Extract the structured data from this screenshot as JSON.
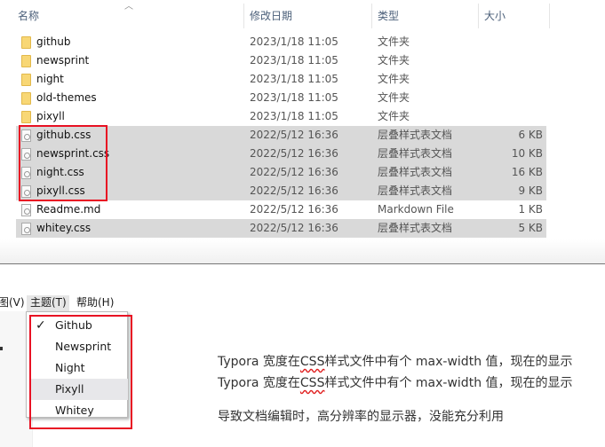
{
  "explorer": {
    "headers": {
      "name": "名称",
      "date": "修改日期",
      "type": "类型",
      "size": "大小"
    },
    "rows": [
      {
        "name": "github",
        "date": "2023/1/18 11:05",
        "type": "文件夹",
        "size": "",
        "icon": "folder",
        "selected": false
      },
      {
        "name": "newsprint",
        "date": "2023/1/18 11:05",
        "type": "文件夹",
        "size": "",
        "icon": "folder",
        "selected": false
      },
      {
        "name": "night",
        "date": "2023/1/18 11:05",
        "type": "文件夹",
        "size": "",
        "icon": "folder",
        "selected": false
      },
      {
        "name": "old-themes",
        "date": "2023/1/18 11:05",
        "type": "文件夹",
        "size": "",
        "icon": "folder",
        "selected": false
      },
      {
        "name": "pixyll",
        "date": "2023/1/18 11:05",
        "type": "文件夹",
        "size": "",
        "icon": "folder",
        "selected": false
      },
      {
        "name": "github.css",
        "date": "2022/5/12 16:36",
        "type": "层叠样式表文档",
        "size": "6 KB",
        "icon": "css",
        "selected": true
      },
      {
        "name": "newsprint.css",
        "date": "2022/5/12 16:36",
        "type": "层叠样式表文档",
        "size": "10 KB",
        "icon": "css",
        "selected": true
      },
      {
        "name": "night.css",
        "date": "2022/5/12 16:36",
        "type": "层叠样式表文档",
        "size": "16 KB",
        "icon": "css",
        "selected": true
      },
      {
        "name": "pixyll.css",
        "date": "2022/5/12 16:36",
        "type": "层叠样式表文档",
        "size": "9 KB",
        "icon": "css",
        "selected": true
      },
      {
        "name": "Readme.md",
        "date": "2022/5/12 16:36",
        "type": "Markdown File",
        "size": "1 KB",
        "icon": "md",
        "selected": false
      },
      {
        "name": "whitey.css",
        "date": "2022/5/12 16:36",
        "type": "层叠样式表文档",
        "size": "5 KB",
        "icon": "css",
        "selected": true
      }
    ]
  },
  "typora": {
    "menu": {
      "view": "图(V)",
      "theme": "主题(T)",
      "help": "帮助(H)"
    },
    "theme_menu": [
      {
        "label": "Github",
        "checked": true
      },
      {
        "label": "Newsprint",
        "checked": false
      },
      {
        "label": "Night",
        "checked": false
      },
      {
        "label": "Pixyll",
        "checked": false,
        "hover": true
      },
      {
        "label": "Whitey",
        "checked": false
      }
    ],
    "check": "✓",
    "content": {
      "line1_a": "Typora 宽度在",
      "line1_b": "CSS",
      "line1_c": "样式文件中有个 max-width 值，现在的显示",
      "line2_a": "Typora 宽度在",
      "line2_b": "CSS",
      "line2_c": "样式文件中有个 max-width 值，现在的显示",
      "line3": "导致文档编辑时，高分辨率的显示器，没能充分利用"
    }
  },
  "colors": {
    "highlight": "#e81123",
    "selection": "#d9d9d9"
  }
}
